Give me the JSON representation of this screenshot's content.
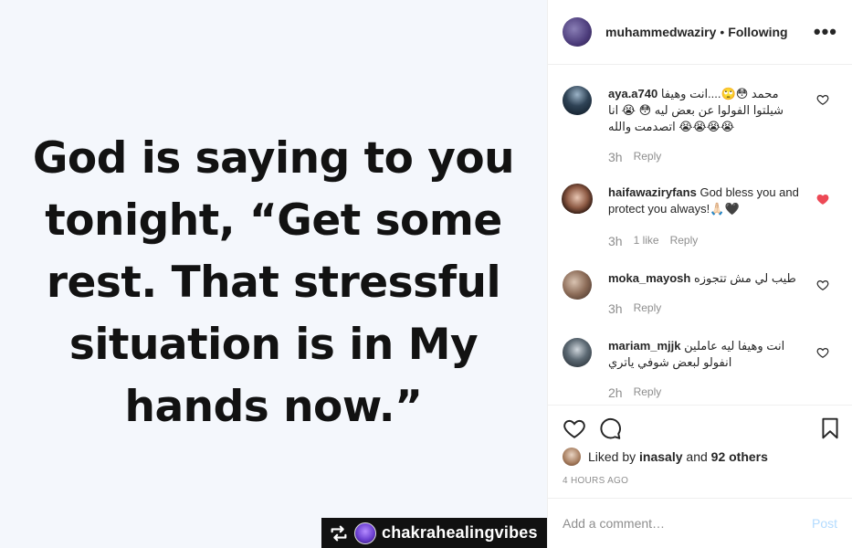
{
  "photo": {
    "quote_lines": [
      "God is saying to you",
      "tonight, “Get some",
      "rest. That stressful",
      "situation is in My",
      "hands now.”"
    ],
    "watermark": {
      "icon": "repost-icon",
      "name": "chakrahealingvibes"
    }
  },
  "header": {
    "username": "muhammedwaziry",
    "separator": "•",
    "follow_status": "Following",
    "more_icon": "more-options-icon"
  },
  "comments": [
    {
      "username": "aya.a740",
      "text": "محمد 😳🙄....انت وهيفا شيلتوا الفولوا عن بعض ليه 😳 😭 انا اتصدمت والله 😭😭😭😭",
      "time": "3h",
      "likes": "",
      "reply": "Reply",
      "liked": false
    },
    {
      "username": "haifawaziryfans",
      "text": "God bless you and protect you always!🙏🏻🖤",
      "time": "3h",
      "likes": "1 like",
      "reply": "Reply",
      "liked": true
    },
    {
      "username": "moka_mayosh",
      "text": "طيب لي مش تتجوزه",
      "time": "3h",
      "likes": "",
      "reply": "Reply",
      "liked": false
    },
    {
      "username": "mariam_mjjk",
      "text": "انت وهيفا ليه عاملين انفولو لبعض شوفي ياتري",
      "time": "2h",
      "likes": "",
      "reply": "Reply",
      "liked": false
    }
  ],
  "actions": {
    "icons": [
      "heart-icon",
      "comment-icon",
      "bookmark-icon"
    ],
    "liked_by_prefix": "Liked by",
    "liked_by_user": "inasaly",
    "liked_by_and": "and",
    "liked_by_others": "92 others",
    "timestamp": "4 HOURS AGO"
  },
  "add_comment": {
    "placeholder": "Add a comment…",
    "post_label": "Post"
  },
  "colors": {
    "like_red": "#ed4956",
    "muted": "#8e8e8e",
    "post_disabled": "#b3dbff",
    "border": "#efefef"
  }
}
